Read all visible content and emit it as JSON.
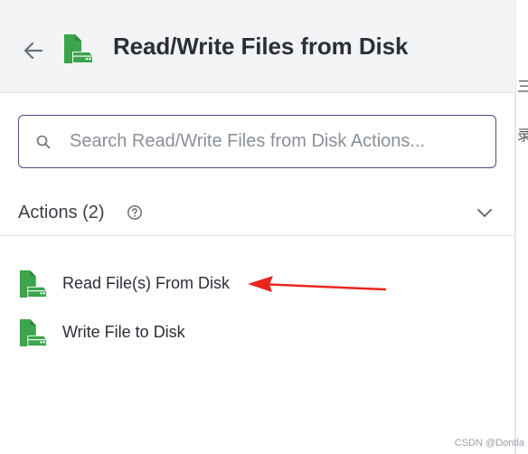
{
  "header": {
    "title": "Read/Write Files from Disk",
    "back_icon": "arrow-left-icon",
    "app_icon": "file-disk-icon"
  },
  "search": {
    "placeholder": "Search Read/Write Files from Disk Actions...",
    "value": ""
  },
  "actions_section": {
    "title": "Actions (2)",
    "help_icon": "question-circle-icon",
    "toggle_icon": "chevron-down-icon",
    "items": [
      {
        "label": "Read File(s) From Disk",
        "icon": "file-disk-icon"
      },
      {
        "label": "Write File to Disk",
        "icon": "file-disk-icon"
      }
    ]
  },
  "annotation": {
    "arrow_color": "#e8261e",
    "target": "Read File(s) From Disk"
  },
  "side_strip": {
    "glyph_top": "三",
    "glyph_bottom": "录"
  },
  "watermark": "CSDN @Dontla",
  "colors": {
    "accent_green": "#3aa54a",
    "search_border": "#4a4e86",
    "header_bg": "#f3f4f6",
    "text_primary": "#2b2f36"
  }
}
